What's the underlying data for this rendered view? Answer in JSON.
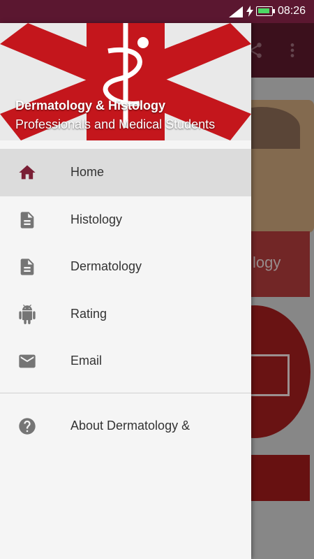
{
  "status_bar": {
    "time": "08:26",
    "icons": [
      "signal-icon",
      "charging-icon",
      "battery-icon"
    ]
  },
  "background_app": {
    "toolbar_actions": [
      "share-icon",
      "more-vert-icon"
    ],
    "button_text": "logy"
  },
  "drawer": {
    "header": {
      "title": "Dermatology & Histology",
      "subtitle": "Professionals and Medical Students",
      "logo": "star-of-life-icon",
      "logo_color": "#c4161c"
    },
    "items": [
      {
        "label": "Home",
        "icon": "home-icon",
        "active": true
      },
      {
        "label": "Histology",
        "icon": "document-icon",
        "active": false
      },
      {
        "label": "Dermatology",
        "icon": "document-icon",
        "active": false
      },
      {
        "label": "Rating",
        "icon": "android-icon",
        "active": false
      },
      {
        "label": "Email",
        "icon": "email-icon",
        "active": false
      }
    ],
    "secondary_items": [
      {
        "label": "About Dermatology &",
        "icon": "help-icon"
      }
    ]
  },
  "colors": {
    "status_bar": "#5b1730",
    "accent": "#7a1f35",
    "active_bg": "#dcdcdc"
  }
}
